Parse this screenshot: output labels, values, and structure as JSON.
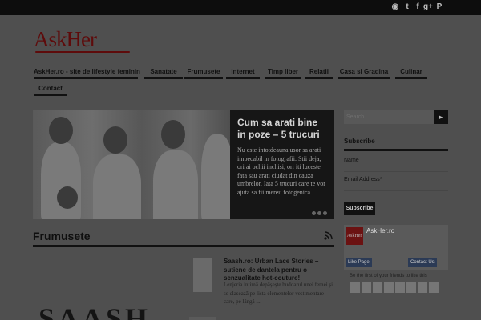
{
  "topbar": {
    "icons": [
      "rss-icon",
      "twitter-icon",
      "facebook-icon",
      "google-plus-icon",
      "pinterest-icon"
    ]
  },
  "logo": {
    "text": "AskHer"
  },
  "nav": {
    "items": [
      "AskHer.ro - site de lifestyle feminin",
      "Sanatate",
      "Frumusete",
      "Internet",
      "Timp liber",
      "Relatii",
      "Casa si Gradina",
      "Culinar",
      "Contact"
    ]
  },
  "featured": {
    "title": "Cum sa arati bine in poze – 5 trucuri",
    "text": "Nu este intotdeauna usor sa arati impecabil in fotografii. Stii deja, ori ai ochii inchisi, ori iti luceste fata sau arati ciudat din cauza umbrelor. Iata 5 trucuri care te vor ajuta sa fii mereu fotogenica."
  },
  "section": {
    "title": "Frumusete"
  },
  "post": {
    "title": "Saash.ro: Urban Lace Stories – sutiene de dantela pentru o senzualitate hot-couture!",
    "excerpt": "Lenjeria intimă depășește budoarul unei femei și se clasează pe lista elementelor vestimentare care, pe lângă ..."
  },
  "brand_image": {
    "text": "SAASH"
  },
  "sidebar": {
    "search_placeholder": "Search",
    "search_button": "►",
    "subscribe_title": "Subscribe",
    "name_label": "Name",
    "email_label": "Email Address*",
    "subscribe_button": "Subscribe",
    "fb_page_name": "AskHer.ro",
    "fb_logo_text": "AskHer",
    "fb_like": "Like Page",
    "fb_contact": "Contact Us",
    "fb_friends_text": "Be the first of your friends to like this"
  }
}
